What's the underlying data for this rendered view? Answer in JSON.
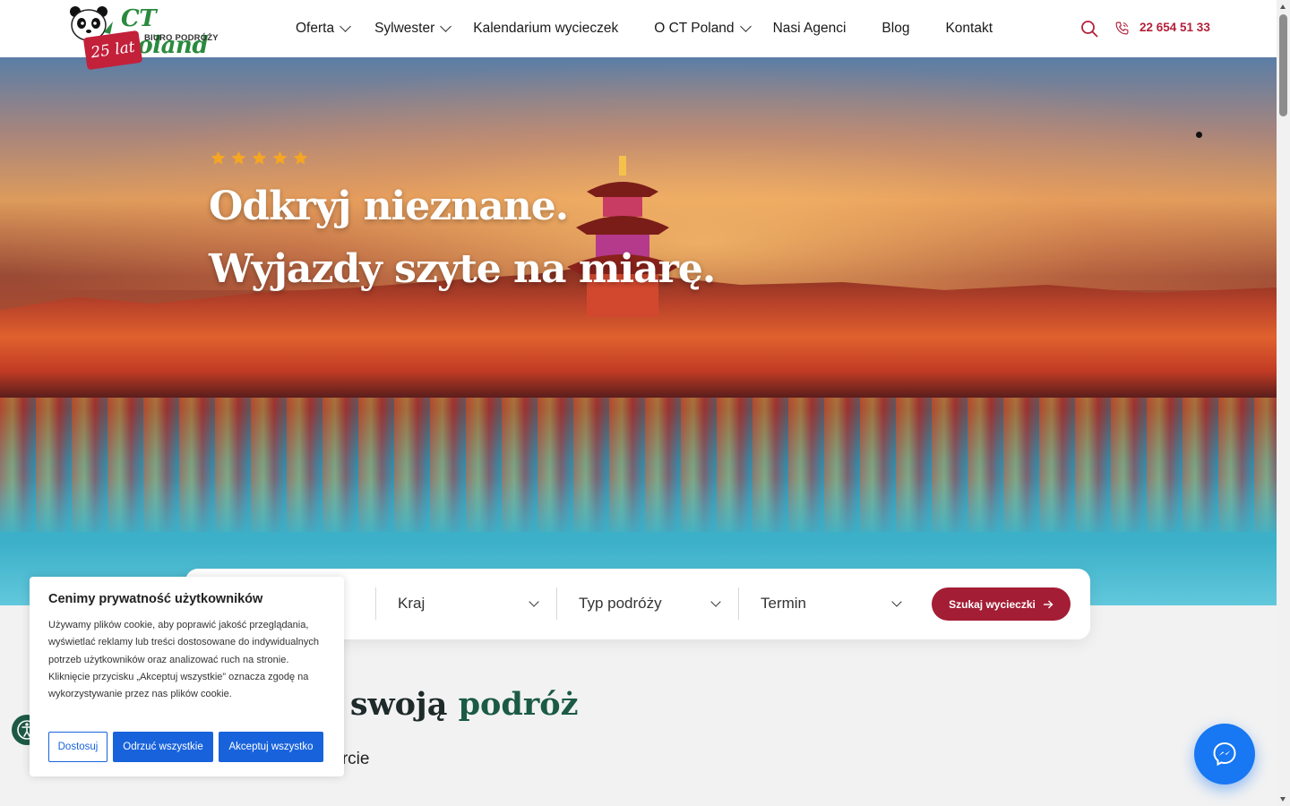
{
  "header": {
    "logo": {
      "name": "CT Poland",
      "subtitle": "BIURO PODRÓŻY",
      "badge": "25 lat"
    },
    "nav": [
      {
        "label": "Oferta",
        "dropdown": true
      },
      {
        "label": "Sylwester",
        "dropdown": true
      },
      {
        "label": "Kalendarium wycieczek",
        "dropdown": false
      },
      {
        "label": "O CT Poland",
        "dropdown": true
      },
      {
        "label": "Nasi Agenci",
        "dropdown": false
      },
      {
        "label": "Blog",
        "dropdown": false
      },
      {
        "label": "Kontakt",
        "dropdown": false
      }
    ],
    "phone": "22 654 51 33",
    "icons": {
      "search": "search-icon",
      "phone": "phone-icon"
    }
  },
  "hero": {
    "rating_stars": 5,
    "title_line1": "Odkryj nieznane.",
    "title_line2": "Wyjazdy szyte na miarę."
  },
  "search": {
    "filters": [
      {
        "label": "Kraj"
      },
      {
        "label": "Typ podróży"
      },
      {
        "label": "Termin"
      }
    ],
    "button_label": "Szukaj wycieczki"
  },
  "section": {
    "title_visible": "j swoją",
    "title_accent": "podróż",
    "subtitle_visible": "forcie"
  },
  "cookie": {
    "title": "Cenimy prywatność użytkowników",
    "body": "Używamy plików cookie, aby poprawić jakość przeglądania, wyświetlać reklamy lub treści dostosowane do indywidualnych potrzeb użytkowników oraz analizować ruch na stronie. Kliknięcie przycisku „Akceptuj wszystkie” oznacza zgodę na wykorzystywanie przez nas plików cookie.",
    "buttons": {
      "customize": "Dostosuj",
      "reject": "Odrzuć wszystkie",
      "accept": "Akceptuj wszystko"
    }
  },
  "colors": {
    "brand_red": "#a31d34",
    "brand_green": "#1b5a45",
    "cookie_blue": "#1863dc",
    "messenger_blue": "#1877f2",
    "star": "#f5a623"
  }
}
